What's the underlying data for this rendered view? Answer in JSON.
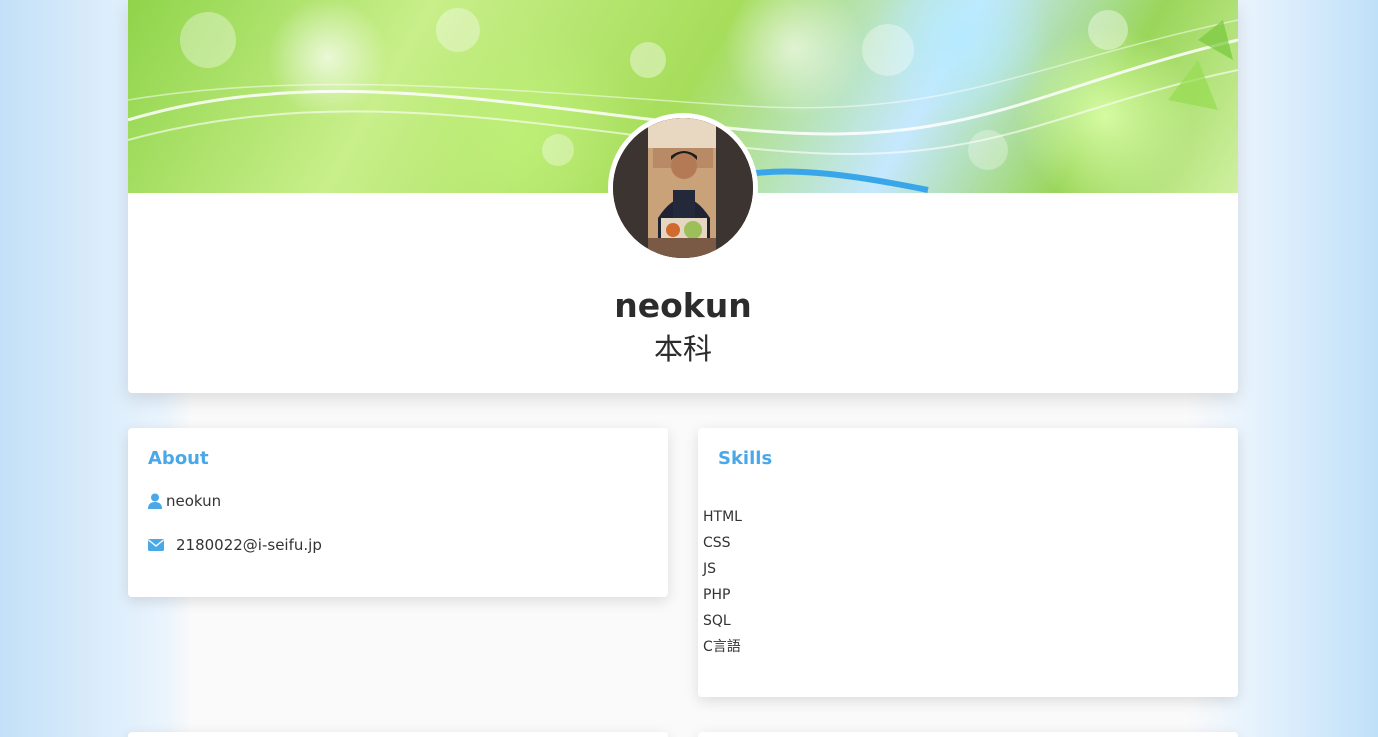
{
  "profile": {
    "name": "neokun",
    "department": "本科"
  },
  "about": {
    "title": "About",
    "username": "neokun",
    "email": "2180022@i-seifu.jp",
    "icons": {
      "user": "user-icon",
      "mail": "envelope-icon"
    }
  },
  "skills": {
    "title": "Skills",
    "items": [
      "HTML",
      "CSS",
      "JS",
      "PHP",
      "SQL",
      "C言語"
    ]
  },
  "colors": {
    "accent": "#4aa8e8",
    "text": "#333333",
    "card": "#ffffff"
  }
}
